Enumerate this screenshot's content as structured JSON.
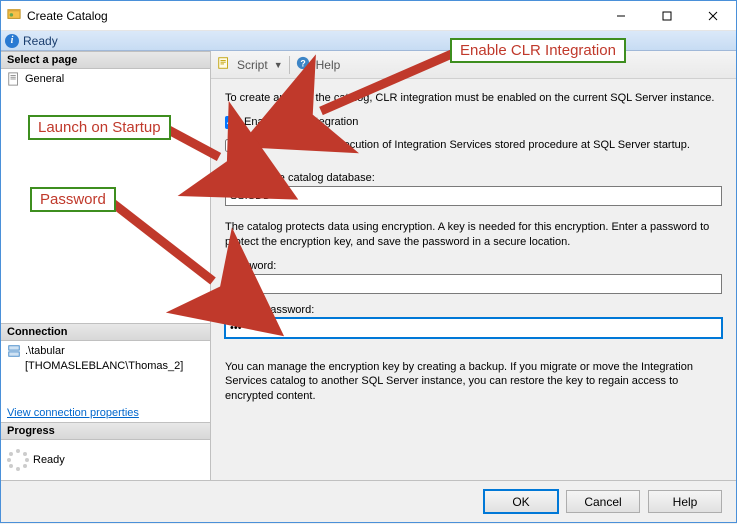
{
  "window": {
    "title": "Create Catalog",
    "ready_label": "Ready"
  },
  "sidebar": {
    "select_page_header": "Select a page",
    "general_label": "General",
    "connection_header": "Connection",
    "server_line": ".\\tabular",
    "user_line": "[THOMASLEBLANC\\Thomas_2]",
    "view_conn_link": "View connection properties",
    "progress_header": "Progress",
    "progress_label": "Ready"
  },
  "toolbar": {
    "script_label": "Script",
    "help_label": "Help"
  },
  "form": {
    "intro": "To create and use the catalog, CLR integration must be enabled on the current SQL Server instance.",
    "enable_clr_label": "Enable CLR Integration",
    "enable_clr_checked": true,
    "auto_exec_label": "Enable automatic execution of Integration Services stored procedure at SQL Server startup.",
    "auto_exec_checked": false,
    "catalog_name_label": "Name of the catalog database:",
    "catalog_name_value": "SSISDB",
    "encryption_text": "The catalog protects data using encryption. A key is needed for this encryption. Enter a password to protect the encryption key, and save the password in a secure location.",
    "password_label": "Password:",
    "password_value": "••••",
    "retype_label": "Retype Password:",
    "retype_value": "•••",
    "manage_text": "You can manage the encryption key by creating a backup. If you migrate or move the Integration Services catalog to another SQL Server instance, you can restore the key to regain access to encrypted content."
  },
  "buttons": {
    "ok": "OK",
    "cancel": "Cancel",
    "help": "Help"
  },
  "annotations": {
    "clr": "Enable CLR Integration",
    "launch": "Launch on Startup",
    "password": "Password"
  }
}
